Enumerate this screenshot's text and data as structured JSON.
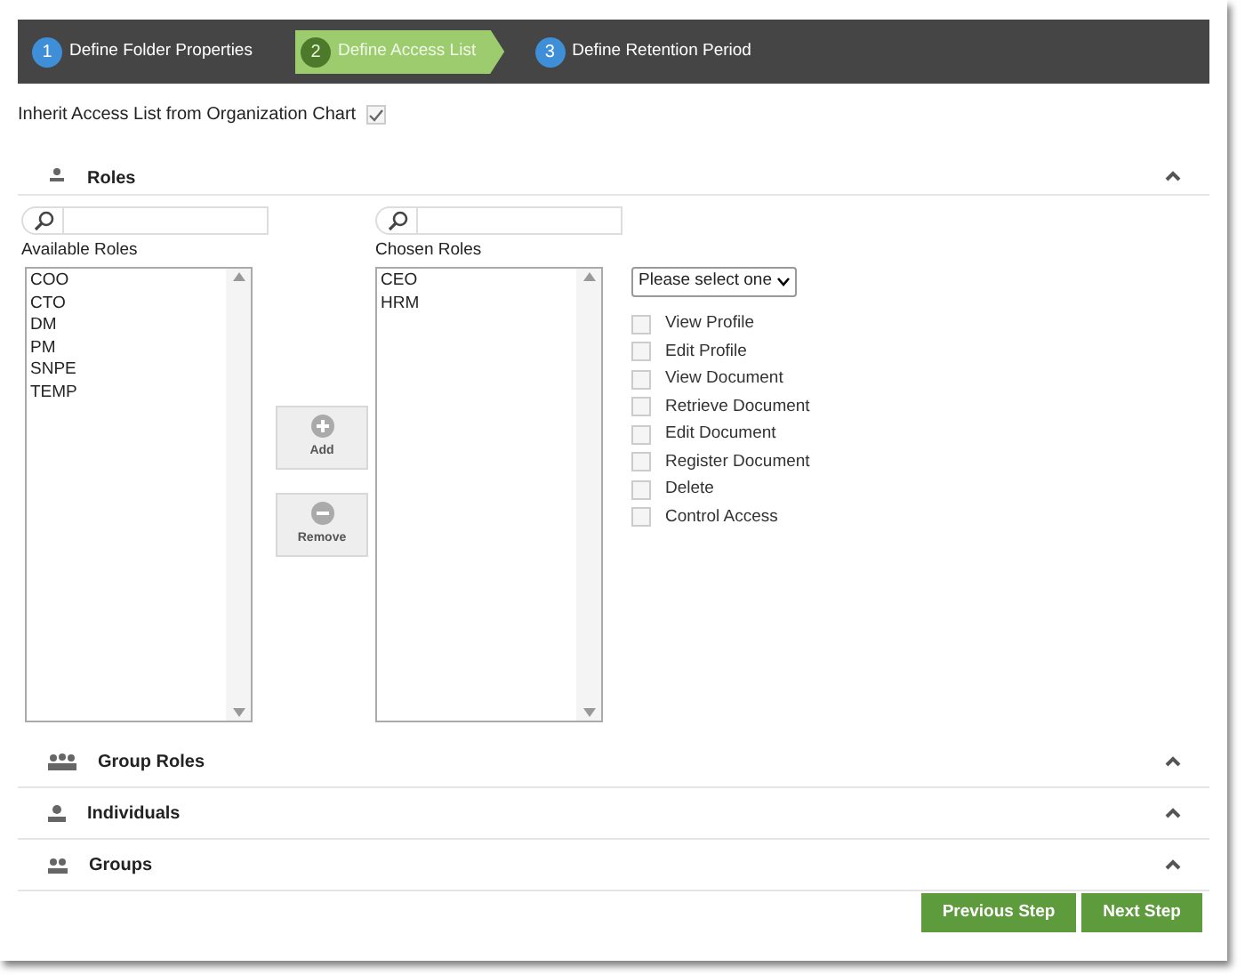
{
  "wizard": {
    "steps": [
      {
        "number": "1",
        "label": "Define Folder Properties",
        "selected": false
      },
      {
        "number": "2",
        "label": "Define Access List",
        "selected": true
      },
      {
        "number": "3",
        "label": "Define Retention Period",
        "selected": false
      }
    ]
  },
  "inherit": {
    "label": "Inherit Access List from Organization Chart",
    "checked": true
  },
  "roles_section": {
    "title": "Roles",
    "kind": "roles",
    "available": {
      "label": "Available Roles",
      "items": [
        "COO",
        "CTO",
        "DM",
        "PM",
        "SNPE",
        "TEMP"
      ]
    },
    "chosen": {
      "label": "Chosen Roles",
      "items": [
        "CEO",
        "HRM"
      ]
    },
    "add_button": "Add",
    "remove_button": "Remove",
    "select": {
      "value": "Please select one"
    },
    "permissions": [
      {
        "label": "View Profile",
        "checked": false
      },
      {
        "label": "Edit Profile",
        "checked": false
      },
      {
        "label": "View Document",
        "checked": false
      },
      {
        "label": "Retrieve Document",
        "checked": false
      },
      {
        "label": "Edit Document",
        "checked": false
      },
      {
        "label": "Register Document",
        "checked": false
      },
      {
        "label": "Delete",
        "checked": false
      },
      {
        "label": "Control Access",
        "checked": false
      }
    ]
  },
  "sections": [
    {
      "title": "Group Roles",
      "kind": "group_roles"
    },
    {
      "title": "Individuals",
      "kind": "individuals"
    },
    {
      "title": "Groups",
      "kind": "groups"
    }
  ],
  "buttons": [
    "Previous Step",
    "Next Step"
  ]
}
